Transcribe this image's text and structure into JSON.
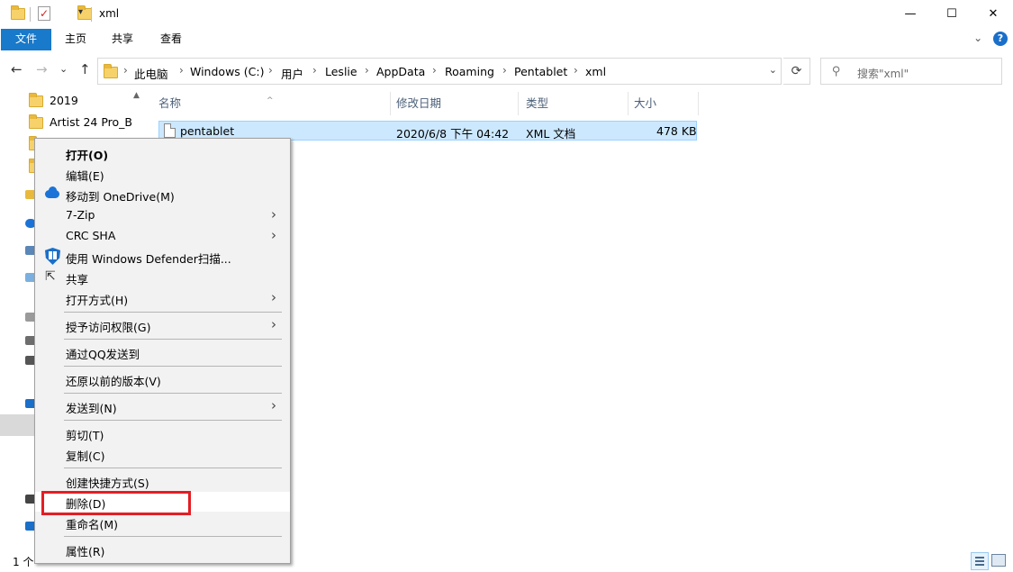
{
  "window": {
    "title": "xml",
    "minimize": "—",
    "maximize": "☐",
    "close": "✕"
  },
  "ribbon": {
    "tabs": [
      "文件",
      "主页",
      "共享",
      "查看"
    ],
    "expand": "⌄",
    "help": "?"
  },
  "nav": {
    "back": "←",
    "forward": "→",
    "recent": "⌄",
    "up": "↑",
    "breadcrumb": [
      "此电脑",
      "Windows (C:)",
      "用户",
      "Leslie",
      "AppData",
      "Roaming",
      "Pentablet",
      "xml"
    ],
    "crumb_sep": "›",
    "dropdown": "⌄",
    "refresh": "⟳"
  },
  "search": {
    "placeholder": "搜索\"xml\"",
    "icon": "search-icon"
  },
  "navpane": {
    "items": [
      "2019",
      "Artist 24 Pro_B"
    ],
    "scroll_up": "▲"
  },
  "filelist": {
    "columns": [
      "名称",
      "修改日期",
      "类型",
      "大小"
    ],
    "sort_indicator": "^",
    "rows": [
      {
        "name": "pentablet",
        "date": "2020/6/8 下午 04:42",
        "type": "XML 文档",
        "size": "478 KB"
      }
    ]
  },
  "status": {
    "text": "1 个"
  },
  "context_menu": {
    "arrow": "›",
    "items": [
      {
        "label": "打开(O)",
        "bold": true
      },
      {
        "label": "编辑(E)"
      },
      {
        "label": "移动到 OneDrive(M)",
        "icon": "onedrive-icon"
      },
      {
        "label": "7-Zip",
        "submenu": true
      },
      {
        "label": "CRC SHA",
        "submenu": true
      },
      {
        "label": "使用 Windows Defender扫描...",
        "icon": "defender-shield-icon"
      },
      {
        "label": "共享",
        "icon": "share-icon"
      },
      {
        "label": "打开方式(H)",
        "submenu": true
      },
      {
        "label": "授予访问权限(G)",
        "submenu": true
      },
      {
        "label": "通过QQ发送到"
      },
      {
        "label": "还原以前的版本(V)"
      },
      {
        "label": "发送到(N)",
        "submenu": true
      },
      {
        "label": "剪切(T)"
      },
      {
        "label": "复制(C)"
      },
      {
        "label": "创建快捷方式(S)"
      },
      {
        "label": "删除(D)",
        "highlighted": true
      },
      {
        "label": "重命名(M)"
      },
      {
        "label": "属性(R)"
      }
    ]
  },
  "colors": {
    "file_tab": "#1979ca",
    "selection": "#cce8ff",
    "highlight_box": "#e31e24",
    "menu_bg": "#f2f2f2"
  }
}
